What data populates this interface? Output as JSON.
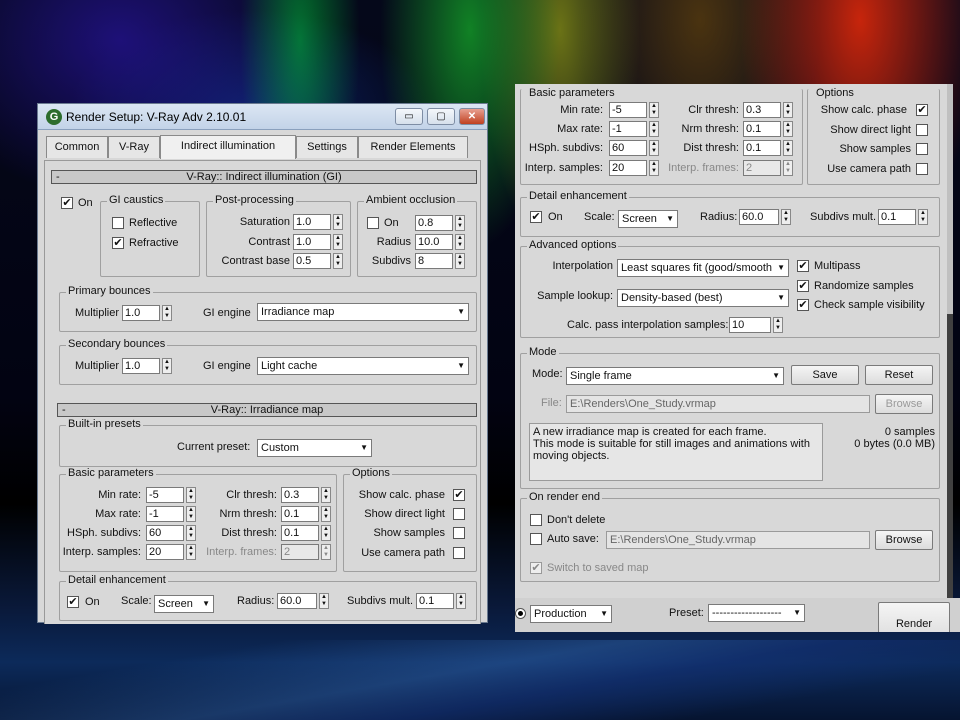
{
  "window": {
    "title": "Render Setup: V-Ray Adv 2.10.01",
    "min": "▭",
    "max": "▢",
    "close": "✕"
  },
  "tabs": [
    "Common",
    "V-Ray",
    "Indirect illumination",
    "Settings",
    "Render Elements"
  ],
  "gi": {
    "rollout": "V-Ray:: Indirect illumination (GI)",
    "on": "On",
    "caustics": {
      "legend": "GI caustics",
      "reflective": "Reflective",
      "refractive": "Refractive"
    },
    "post": {
      "legend": "Post-processing",
      "saturation": "Saturation",
      "saturation_v": "1.0",
      "contrast": "Contrast",
      "contrast_v": "1.0",
      "contrast_base": "Contrast base",
      "contrast_base_v": "0.5"
    },
    "ao": {
      "legend": "Ambient occlusion",
      "on": "On",
      "on_v": "0.8",
      "radius": "Radius",
      "radius_v": "10.0",
      "subdivs": "Subdivs",
      "subdivs_v": "8"
    },
    "primary": {
      "legend": "Primary bounces",
      "multiplier": "Multiplier",
      "multiplier_v": "1.0",
      "engine": "GI engine",
      "engine_v": "Irradiance map"
    },
    "secondary": {
      "legend": "Secondary bounces",
      "multiplier": "Multiplier",
      "multiplier_v": "1.0",
      "engine": "GI engine",
      "engine_v": "Light cache"
    }
  },
  "irr": {
    "rollout": "V-Ray:: Irradiance map",
    "presets": {
      "legend": "Built-in presets",
      "current": "Current preset:",
      "current_v": "Custom"
    },
    "basic": {
      "legend": "Basic parameters",
      "min_rate": "Min rate:",
      "min_rate_v": "-5",
      "max_rate": "Max rate:",
      "max_rate_v": "-1",
      "hsph": "HSph. subdivs:",
      "hsph_v": "60",
      "interp": "Interp. samples:",
      "interp_v": "20",
      "clr": "Clr thresh:",
      "clr_v": "0.3",
      "nrm": "Nrm thresh:",
      "nrm_v": "0.1",
      "dist": "Dist thresh:",
      "dist_v": "0.1",
      "frames": "Interp. frames:",
      "frames_v": "2"
    },
    "options": {
      "legend": "Options",
      "show_calc": "Show calc. phase",
      "show_direct": "Show direct light",
      "show_samples": "Show samples",
      "use_camera": "Use camera path"
    },
    "detail": {
      "legend": "Detail enhancement",
      "on": "On",
      "scale": "Scale:",
      "scale_v": "Screen",
      "radius": "Radius:",
      "radius_v": "60.0",
      "subdivs": "Subdivs mult.",
      "subdivs_v": "0.1"
    },
    "advanced": {
      "legend": "Advanced options",
      "interpolation": "Interpolation",
      "interpolation_v": "Least squares fit (good/smooth",
      "lookup": "Sample lookup:",
      "lookup_v": "Density-based (best)",
      "calc": "Calc. pass interpolation samples:",
      "calc_v": "10",
      "multipass": "Multipass",
      "randomize": "Randomize samples",
      "check": "Check sample visibility"
    },
    "mode": {
      "legend": "Mode",
      "mode": "Mode:",
      "mode_v": "Single frame",
      "save": "Save",
      "reset": "Reset",
      "file": "File:",
      "file_v": "E:\\Renders\\One_Study.vrmap",
      "browse": "Browse",
      "note": "A new irradiance map is created for each frame.\nThis mode is suitable for still images and animations with moving objects.",
      "samples": "0 samples",
      "bytes": "0 bytes (0.0 MB)"
    },
    "end": {
      "legend": "On render end",
      "dont_delete": "Don't delete",
      "auto_save": "Auto save:",
      "auto_save_v": "E:\\Renders\\One_Study.vrmap",
      "browse": "Browse",
      "switch": "Switch to saved map"
    }
  },
  "bottom": {
    "production": "Production",
    "preset": "Preset:",
    "preset_v": "-------------------",
    "render": "Render"
  }
}
